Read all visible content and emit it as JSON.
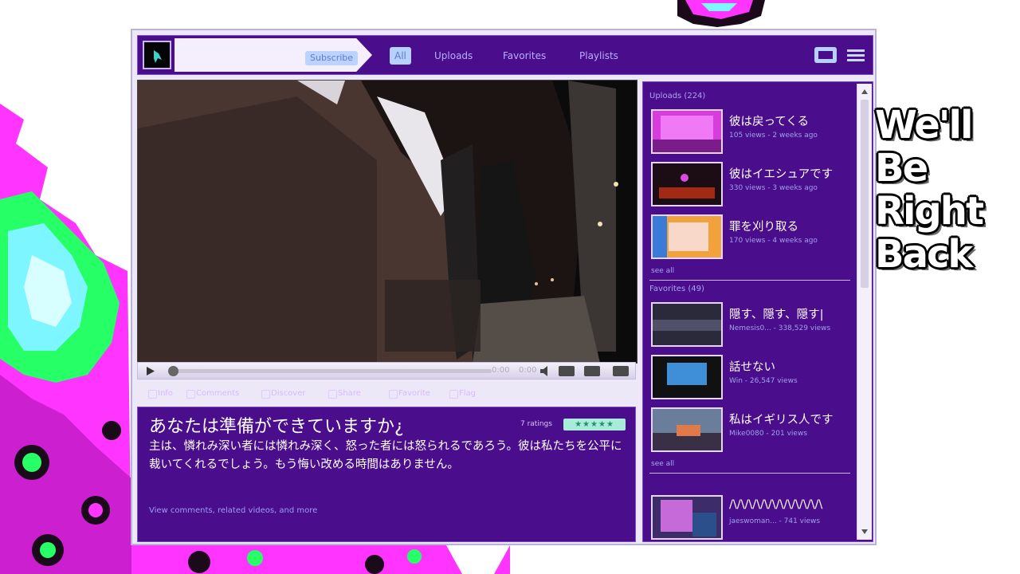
{
  "colors": {
    "accent_purple": "#4a0d8c",
    "highlight_blue": "#b6d0ff",
    "fractal_magenta": "#ff3cff",
    "fractal_green": "#46ff7a"
  },
  "channel": {
    "subscribe_label": "Subscribe"
  },
  "tabs": [
    {
      "label": "All",
      "active": true
    },
    {
      "label": "Uploads",
      "active": false
    },
    {
      "label": "Favorites",
      "active": false
    },
    {
      "label": "Playlists",
      "active": false
    }
  ],
  "player": {
    "current_time": "0:00",
    "duration": "0:00",
    "progress": 0.0
  },
  "actions": [
    "Info",
    "Comments",
    "Discover",
    "Share",
    "Favorite",
    "Flag"
  ],
  "video_info": {
    "title": "あなたは準備ができていますか¿",
    "ratings_label": "7 ratings",
    "stars": "★★★★★",
    "description": "主は、憐れみ深い者には憐れみ深く、怒った者には怒られるであろう。彼は私たちを公平に裁いてくれるでしょう。もう悔い改める時間はありません。",
    "more_link": "View comments, related videos, and more"
  },
  "sidebar": {
    "uploads_title": "Uploads (224)",
    "favorites_title": "Favorites (49)",
    "see_all": "see all",
    "uploads": [
      {
        "title": "彼は戻ってくる",
        "meta": "105 views - 2 weeks ago"
      },
      {
        "title": "彼はイエシュアです",
        "meta": "330 views - 3 weeks ago"
      },
      {
        "title": "罪を刈り取る",
        "meta": "170 views - 4 weeks ago"
      }
    ],
    "favorites": [
      {
        "title": "隠す、隠す、隠す|",
        "meta": "Nemesis0... - 338,529 views"
      },
      {
        "title": "話せない",
        "meta": "Win - 26,547 views"
      },
      {
        "title": "私はイギリス人です",
        "meta": "Mike0080 - 201 views"
      }
    ],
    "extra": {
      "title": "/\\/\\/\\/\\/\\/\\/\\/\\/\\/\\/\\/\\",
      "meta": "jaeswoman... - 741 views"
    }
  },
  "overlay": {
    "line1": "We'll",
    "line2": "Be",
    "line3": "Right",
    "line4": "Back"
  }
}
